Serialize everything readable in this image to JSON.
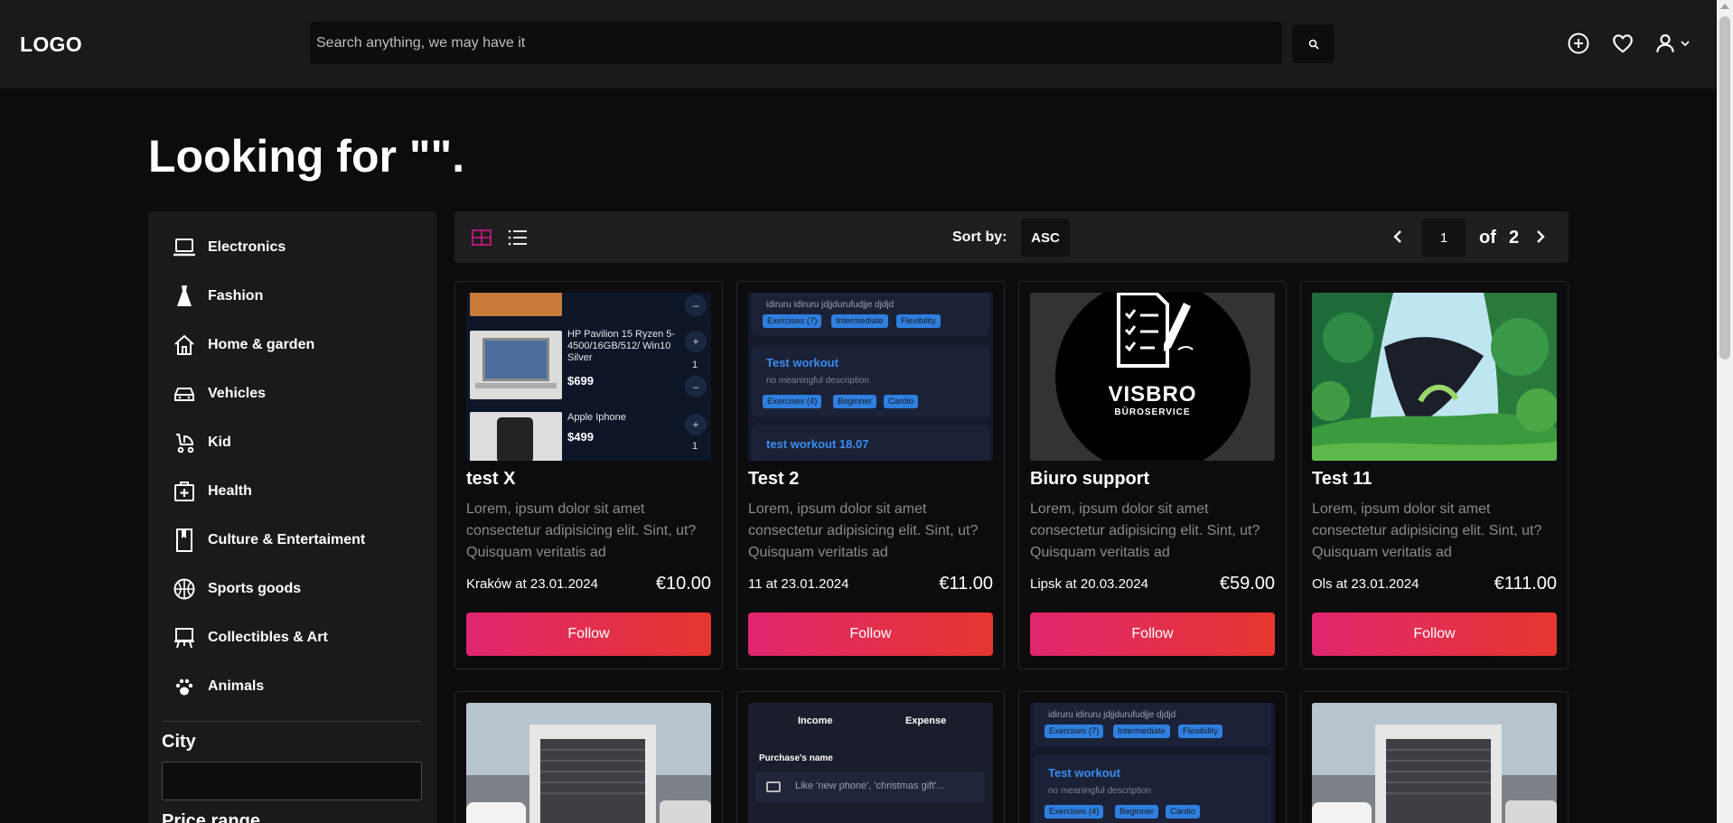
{
  "header": {
    "logo": "LOGO",
    "search_placeholder": "Search anything, we may have it",
    "icons": [
      "search-icon",
      "add-circle-icon",
      "heart-icon",
      "user-icon",
      "chevron-down-icon"
    ]
  },
  "page": {
    "title": "Looking for \"\"."
  },
  "sidebar": {
    "categories": [
      {
        "label": "Electronics",
        "icon": "laptop-icon"
      },
      {
        "label": "Fashion",
        "icon": "dress-icon"
      },
      {
        "label": "Home & garden",
        "icon": "house-icon"
      },
      {
        "label": "Vehicles",
        "icon": "car-icon"
      },
      {
        "label": "Kid",
        "icon": "stroller-icon"
      },
      {
        "label": "Health",
        "icon": "medical-kit-icon"
      },
      {
        "label": "Culture & Entertaiment",
        "icon": "book-icon"
      },
      {
        "label": "Sports goods",
        "icon": "basketball-icon"
      },
      {
        "label": "Collectibles & Art",
        "icon": "easel-icon"
      },
      {
        "label": "Animals",
        "icon": "paw-icon"
      }
    ],
    "city_label": "City",
    "city_value": "",
    "price_label": "Price range"
  },
  "toolbar": {
    "sort_label": "Sort by:",
    "sort_value": "ASC",
    "current_page": "1",
    "of_label": "of",
    "total_pages": "2",
    "accent_color": "#c2187a"
  },
  "cards": [
    {
      "title": "test X",
      "description": "Lorem, ipsum dolor sit amet consectetur adipisicing elit. Sint, ut? Quisquam veritatis ad",
      "location": "Kraków at 23.01.2024",
      "price": "€10.00",
      "follow_label": "Follow",
      "thumb": {
        "item1": "HP Pavilion 15 Ryzen 5-4500/16GB/512/ Win10 Silver",
        "price1": "$699",
        "item2": "Apple Iphone",
        "price2": "$499",
        "qty": "1"
      }
    },
    {
      "title": "Test 2",
      "description": "Lorem, ipsum dolor sit amet consectetur adipisicing elit. Sint, ut? Quisquam veritatis ad",
      "location": "11 at 23.01.2024",
      "price": "€11.00",
      "follow_label": "Follow",
      "thumb": {
        "top_text": "idiruru idiruru jdjjdurufudjje djdjd",
        "tags_a": [
          "Exercises (7)",
          "Intermediate",
          "Flexibility"
        ],
        "workout_title": "Test workout",
        "workout_desc": "no meaningful description",
        "tags_b": [
          "Exercises (4)",
          "Beginner",
          "Cardio"
        ],
        "workout2_title": "test workout 18.07"
      }
    },
    {
      "title": "Biuro support",
      "description": "Lorem, ipsum dolor sit amet consectetur adipisicing elit. Sint, ut? Quisquam veritatis ad",
      "location": "Lipsk at 20.03.2024",
      "price": "€59.00",
      "follow_label": "Follow",
      "thumb": {
        "brand": "VISBRO",
        "sub": "BÜROSERVICE"
      }
    },
    {
      "title": "Test 11",
      "description": "Lorem, ipsum dolor sit amet consectetur adipisicing elit. Sint, ut? Quisquam veritatis ad",
      "location": "Ols at 23.01.2024",
      "price": "€111.00",
      "follow_label": "Follow"
    }
  ],
  "row2": {
    "finance": {
      "income": "Income",
      "expense": "Expense",
      "purchase_label": "Purchase's name",
      "purchase_placeholder": "Like 'new phone', 'christmas gift'..."
    },
    "workout": {
      "top_text": "idiruru idiruru jdjjdurufudjje djdjd",
      "tags_a": [
        "Exercises (7)",
        "Intermediate",
        "Flexibility"
      ],
      "workout_title": "Test workout",
      "workout_desc": "no meaningful description",
      "tags_b": [
        "Exercises (4)",
        "Beginner",
        "Cardio"
      ]
    }
  }
}
